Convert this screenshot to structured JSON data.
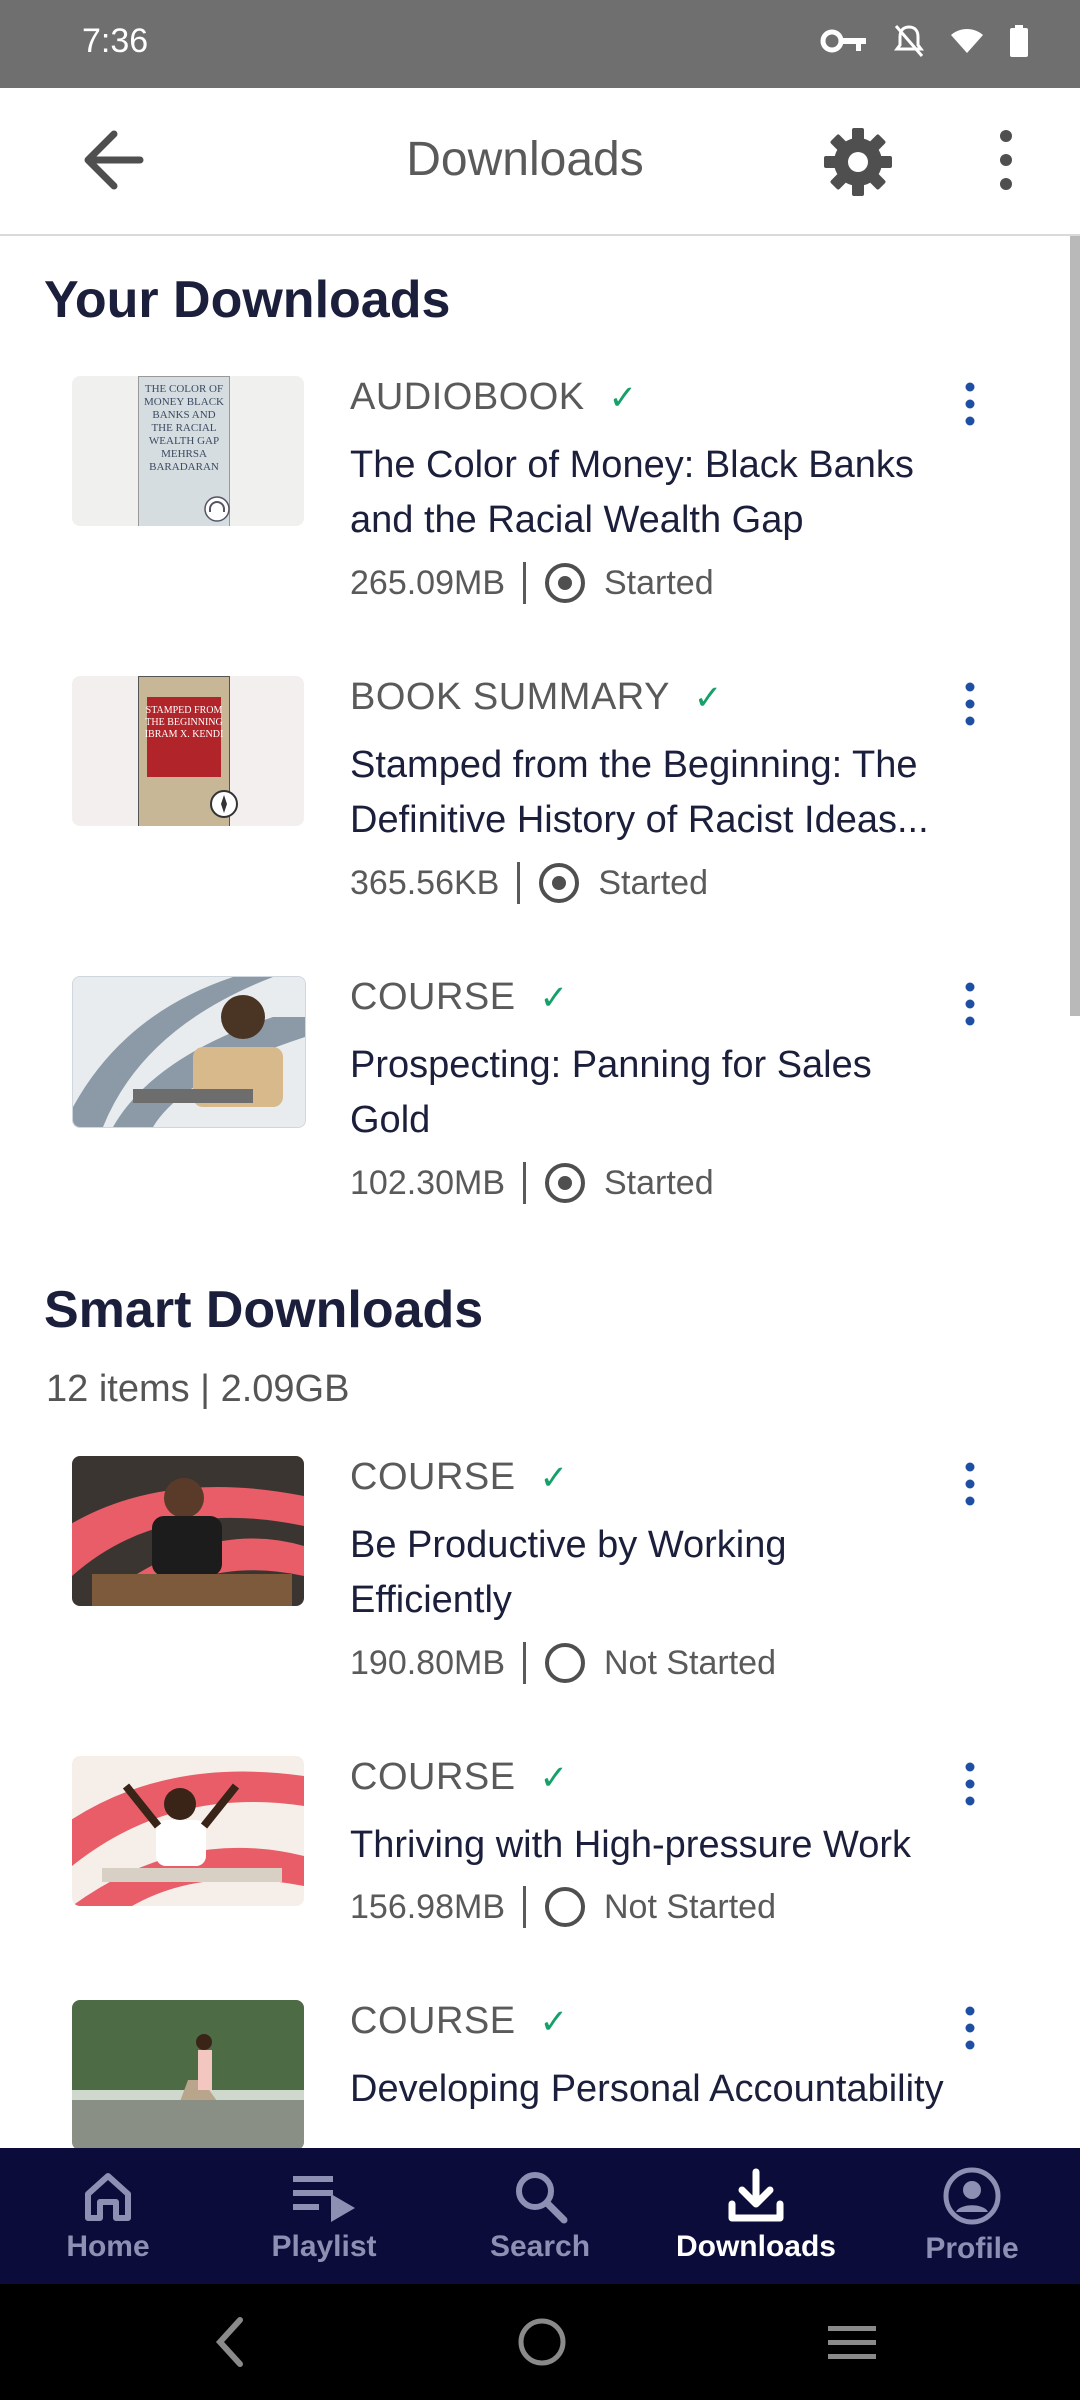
{
  "status_bar": {
    "time": "7:36",
    "icons": [
      "key-icon",
      "bell-off-icon",
      "wifi-icon",
      "battery-icon"
    ]
  },
  "app_bar": {
    "title": "Downloads"
  },
  "your_downloads": {
    "title": "Your Downloads",
    "items": [
      {
        "type": "AUDIOBOOK",
        "title": "The Color of Money: Black Banks and the Racial Wealth Gap",
        "size": "265.09MB",
        "status": "Started",
        "thumb_text": "THE COLOR OF MONEY BLACK BANKS AND THE RACIAL WEALTH GAP MEHRSA BARADARAN"
      },
      {
        "type": "BOOK SUMMARY",
        "title": "Stamped from the Beginning: The Definitive History of Racist Ideas...",
        "size": "365.56KB",
        "status": "Started",
        "thumb_text": "STAMPED FROM THE BEGINNING IBRAM X. KENDI"
      },
      {
        "type": "COURSE",
        "title": "Prospecting: Panning for Sales Gold",
        "size": "102.30MB",
        "status": "Started"
      }
    ]
  },
  "smart_downloads": {
    "title": "Smart Downloads",
    "summary": "12 items | 2.09GB",
    "items": [
      {
        "type": "COURSE",
        "title": "Be Productive by Working Efficiently",
        "size": "190.80MB",
        "status": "Not Started"
      },
      {
        "type": "COURSE",
        "title": "Thriving with High-pressure Work",
        "size": "156.98MB",
        "status": "Not Started"
      },
      {
        "type": "COURSE",
        "title": "Developing Personal Accountability",
        "size": "",
        "status": ""
      }
    ]
  },
  "bottom_nav": [
    {
      "label": "Home",
      "icon": "home-icon"
    },
    {
      "label": "Playlist",
      "icon": "playlist-icon"
    },
    {
      "label": "Search",
      "icon": "search-icon"
    },
    {
      "label": "Downloads",
      "icon": "download-icon",
      "active": true
    },
    {
      "label": "Profile",
      "icon": "profile-icon"
    }
  ],
  "colors": {
    "accent_navy": "#0b0c3a",
    "check_green": "#16a06a",
    "kebab_blue": "#1f4fa3",
    "thumb_red": "#e85d67"
  }
}
